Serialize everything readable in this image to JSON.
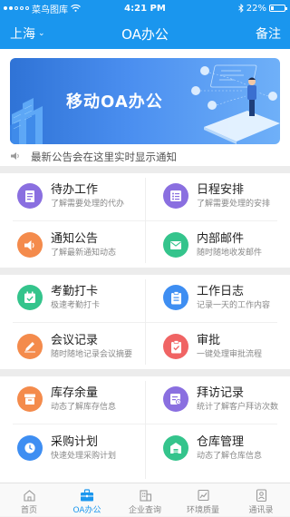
{
  "status_bar": {
    "carrier": "菜鸟图库",
    "time": "4:21 PM",
    "battery": "22%"
  },
  "nav": {
    "location": "上海",
    "title": "OA办公",
    "right_action": "备注"
  },
  "banner": {
    "title": "移动OA办公"
  },
  "notice": {
    "text": "最新公告会在这里实时显示通知"
  },
  "sections": [
    {
      "tiles": [
        {
          "title": "待办工作",
          "subtitle": "了解需要处理的代办",
          "icon": "todo-doc-icon",
          "color": "#8a6fe0"
        },
        {
          "title": "日程安排",
          "subtitle": "了解需要处理的安排",
          "icon": "schedule-list-icon",
          "color": "#8a6fe0"
        },
        {
          "title": "通知公告",
          "subtitle": "了解最新通知动态",
          "icon": "speaker-icon",
          "color": "#f48b4c"
        },
        {
          "title": "内部邮件",
          "subtitle": "随时随地收发邮件",
          "icon": "mail-icon",
          "color": "#34c48c"
        }
      ]
    },
    {
      "tiles": [
        {
          "title": "考勤打卡",
          "subtitle": "极速考勤打卡",
          "icon": "calendar-check-icon",
          "color": "#34c48c"
        },
        {
          "title": "工作日志",
          "subtitle": "记录一天的工作内容",
          "icon": "clipboard-icon",
          "color": "#3e8ef2"
        },
        {
          "title": "会议记录",
          "subtitle": "随时随地记录会议摘要",
          "icon": "pencil-icon",
          "color": "#f48b4c"
        },
        {
          "title": "审批",
          "subtitle": "一键处理审批流程",
          "icon": "approval-icon",
          "color": "#f06464"
        }
      ]
    },
    {
      "tiles": [
        {
          "title": "库存余量",
          "subtitle": "动态了解库存信息",
          "icon": "inventory-box-icon",
          "color": "#f48b4c"
        },
        {
          "title": "拜访记录",
          "subtitle": "统计了解客户拜访次数",
          "icon": "visit-record-icon",
          "color": "#8a6fe0"
        },
        {
          "title": "采购计划",
          "subtitle": "快速处理采购计划",
          "icon": "purchase-plan-icon",
          "color": "#3e8ef2"
        },
        {
          "title": "仓库管理",
          "subtitle": "动态了解仓库信息",
          "icon": "warehouse-icon",
          "color": "#34c48c"
        }
      ]
    }
  ],
  "tab_bar": {
    "active_index": 1,
    "active_color": "#1a96ee",
    "tabs": [
      {
        "label": "首页",
        "icon": "home-icon"
      },
      {
        "label": "OA办公",
        "icon": "briefcase-icon"
      },
      {
        "label": "企业查询",
        "icon": "building-icon"
      },
      {
        "label": "环境质量",
        "icon": "environment-icon"
      },
      {
        "label": "通讯录",
        "icon": "contacts-icon"
      }
    ]
  }
}
